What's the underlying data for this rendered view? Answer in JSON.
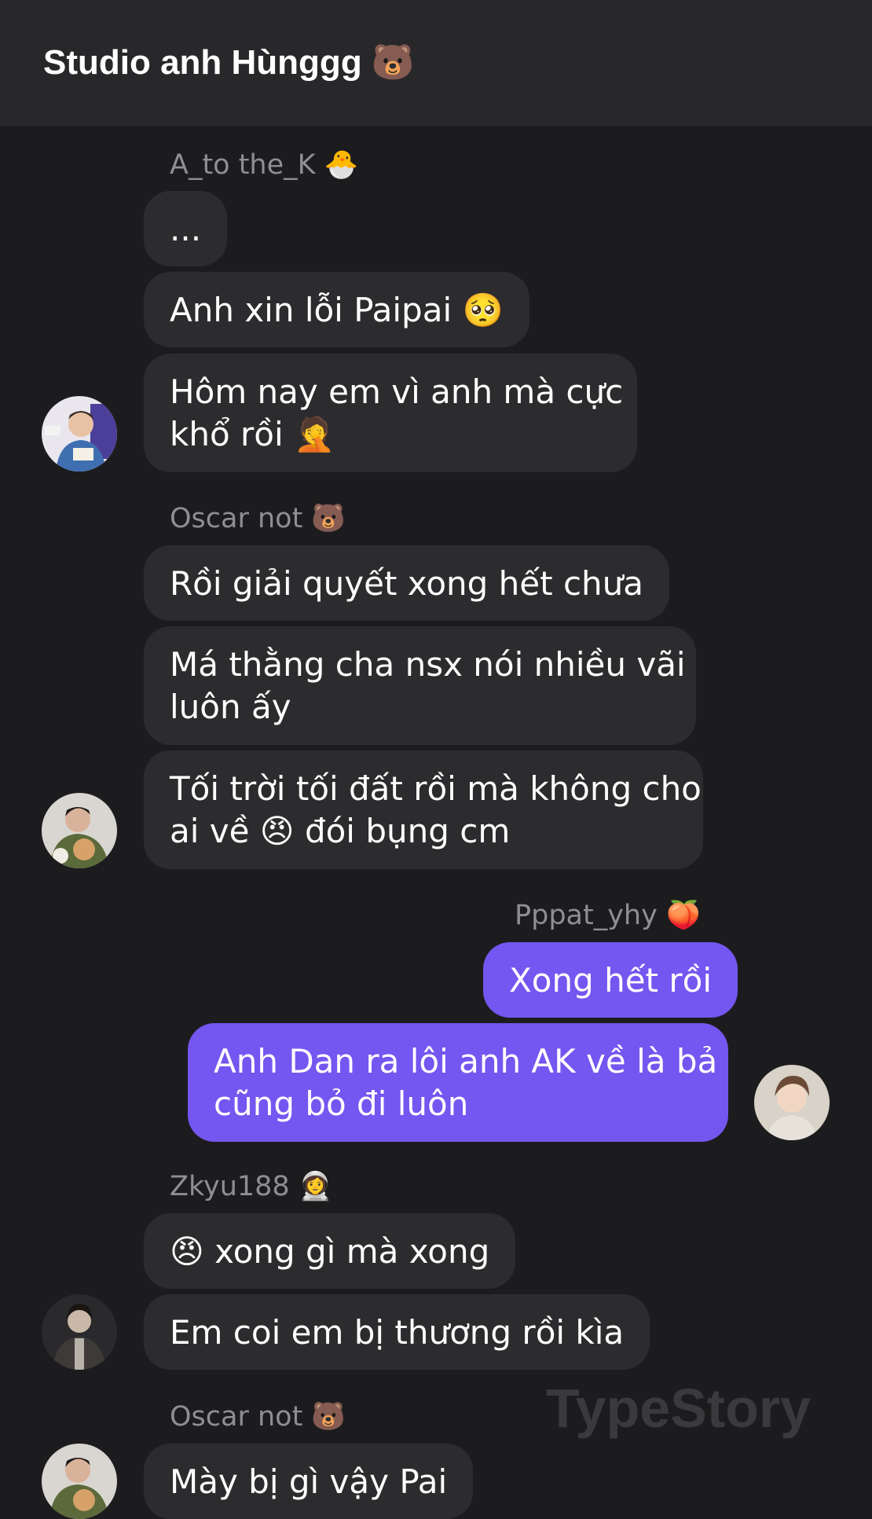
{
  "header": {
    "title": "Studio anh Hùnggg 🐻"
  },
  "messages": [
    {
      "sender": "A_to the_K 🐣",
      "bubbles": [
        "...",
        "Anh xin lỗi Paipai 🥺",
        "Hôm nay em vì anh mà cực|khổ rồi 🤦"
      ]
    },
    {
      "sender": "Oscar not 🐻",
      "bubbles": [
        "Rồi giải quyết xong hết chưa",
        "Má thằng cha nsx nói nhiều vãi|luôn ấy",
        "Tối trời tối đất rồi mà không cho|ai về 😠 đói bụng cm"
      ]
    },
    {
      "sender": "Pppat_yhy 🍑",
      "bubbles": [
        "Xong hết rồi",
        "Anh Dan ra lôi anh AK về là bả|cũng bỏ đi luôn"
      ]
    },
    {
      "sender": "Zkyu188 👩‍🚀",
      "bubbles": [
        "😠 xong gì mà xong",
        "Em coi em bị thương rồi kìa"
      ]
    },
    {
      "sender": "Oscar not 🐻",
      "bubbles": [
        "Mày bị gì vậy Pai"
      ]
    }
  ],
  "watermark": "TypeStory",
  "colors": {
    "background": "#1c1c1e",
    "header": "#28282a",
    "incoming_bubble": "#2c2c2e",
    "outgoing_bubble": "#7456f0",
    "sender_text": "#8e8e93"
  },
  "icons": [
    "avatar-user-ak",
    "avatar-user-oscar",
    "avatar-user-pppat",
    "avatar-user-zkyu"
  ]
}
